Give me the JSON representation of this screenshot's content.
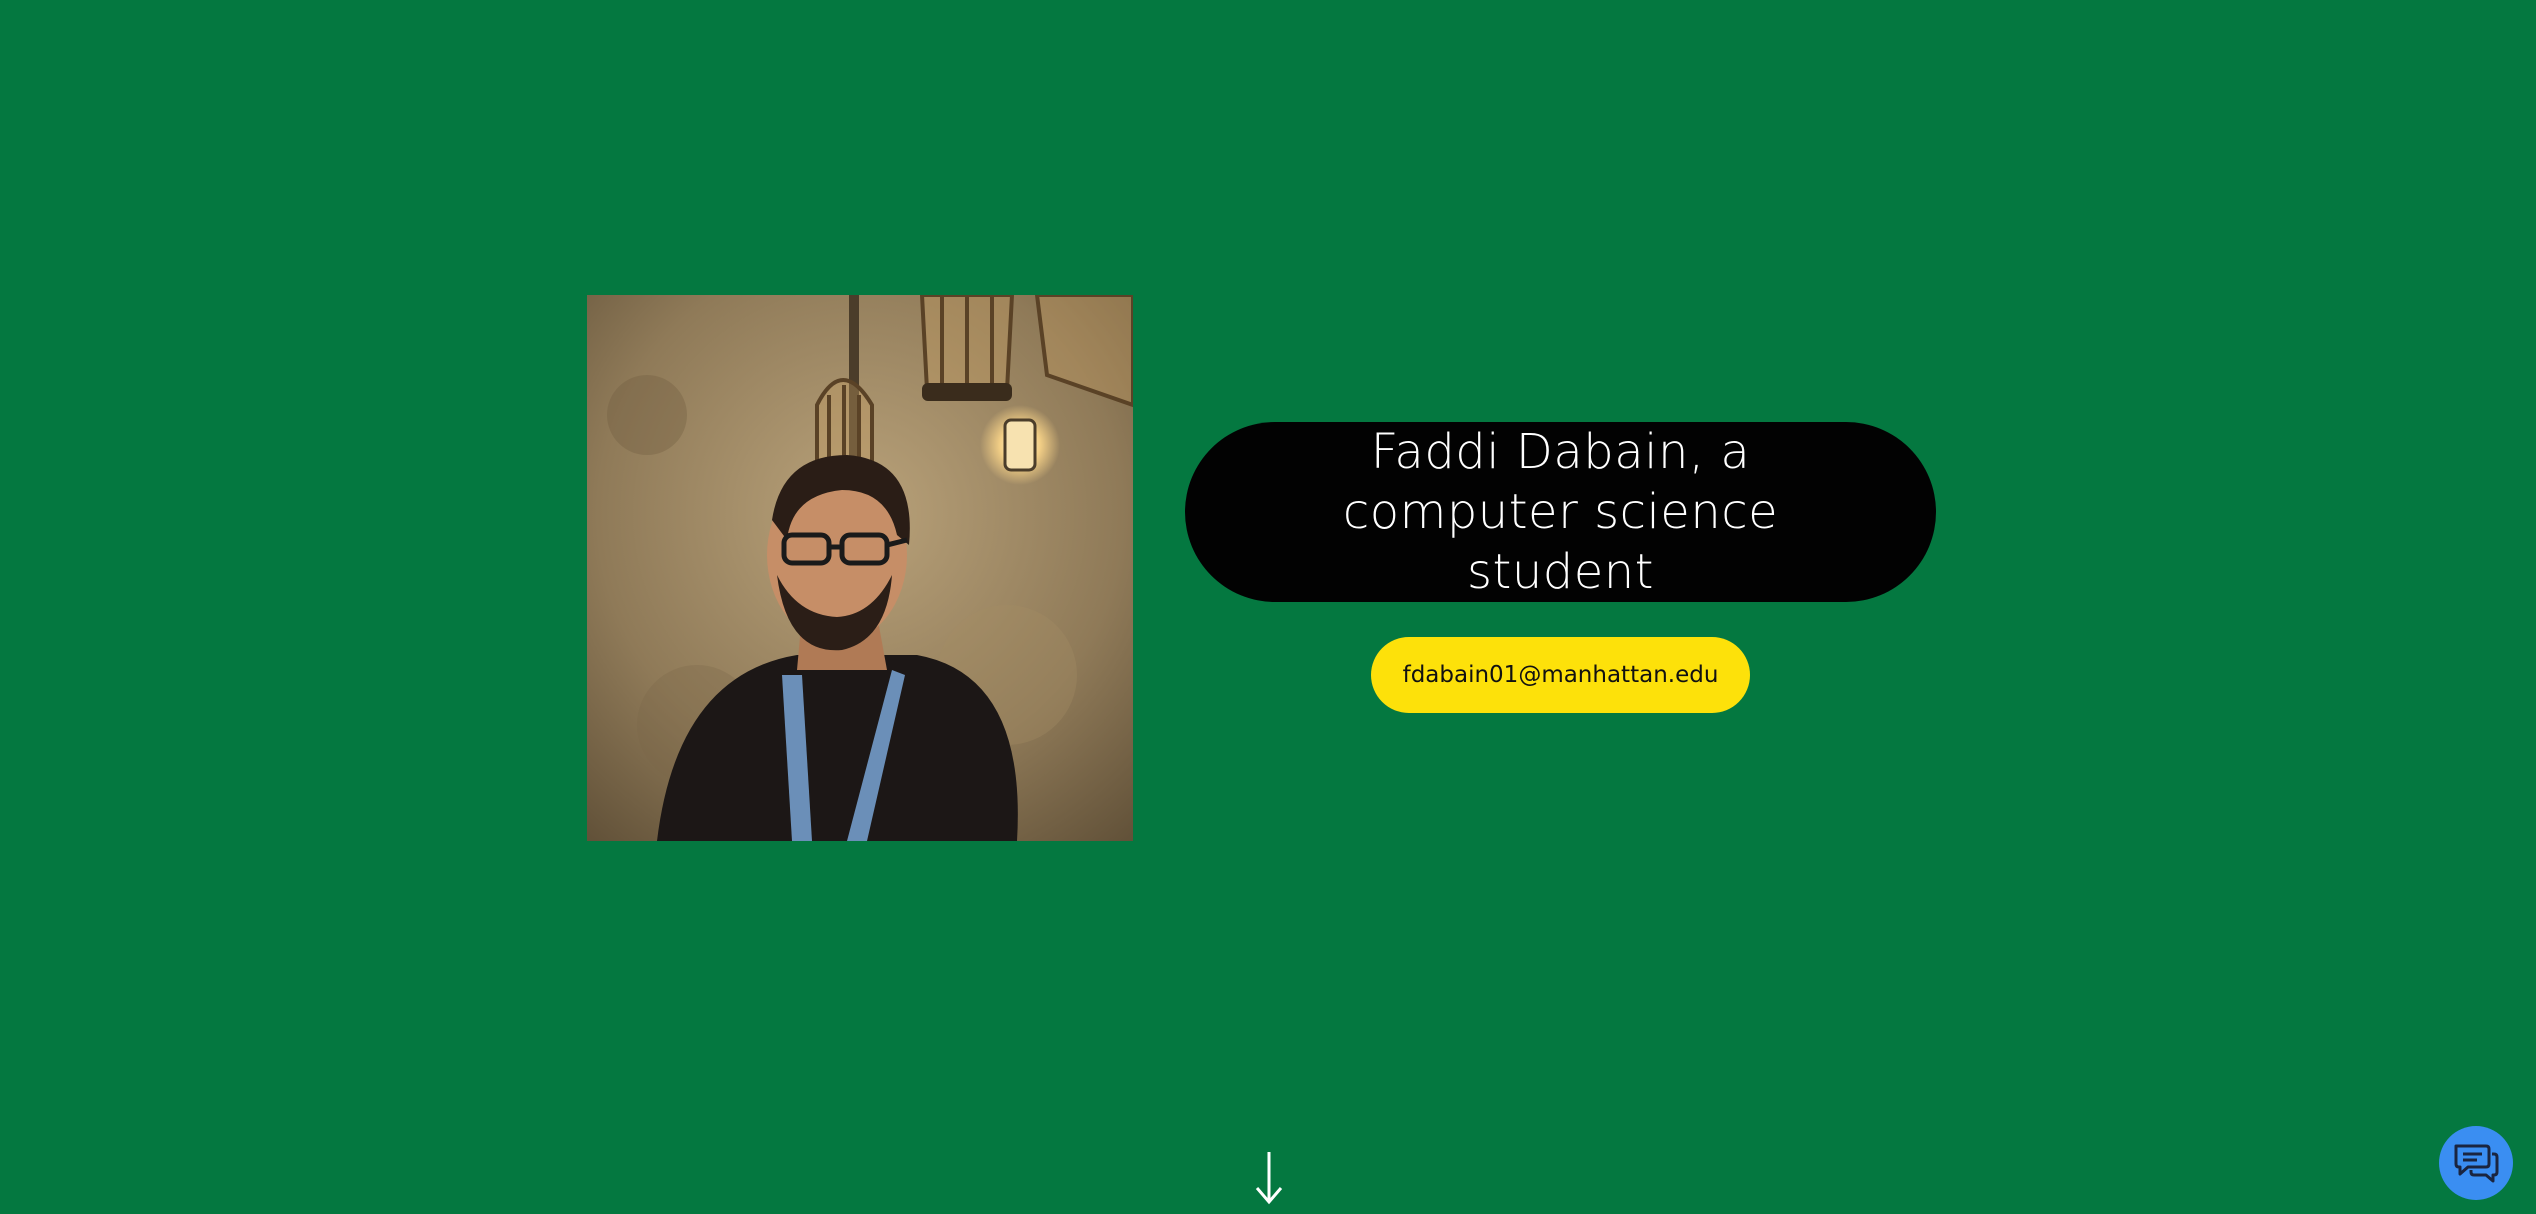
{
  "profile": {
    "photo_icon": "portrait-photo",
    "headline": "Faddi Dabain, a computer science student",
    "email": "fdabain01@manhattan.edu"
  },
  "navigation": {
    "scroll_icon": "arrow-down-icon"
  },
  "chat": {
    "icon": "chat-bubbles-icon"
  },
  "colors": {
    "background": "#047840",
    "name_pill": "#020202",
    "email_button": "#fde10a",
    "chat_button": "#3a8ef2"
  }
}
